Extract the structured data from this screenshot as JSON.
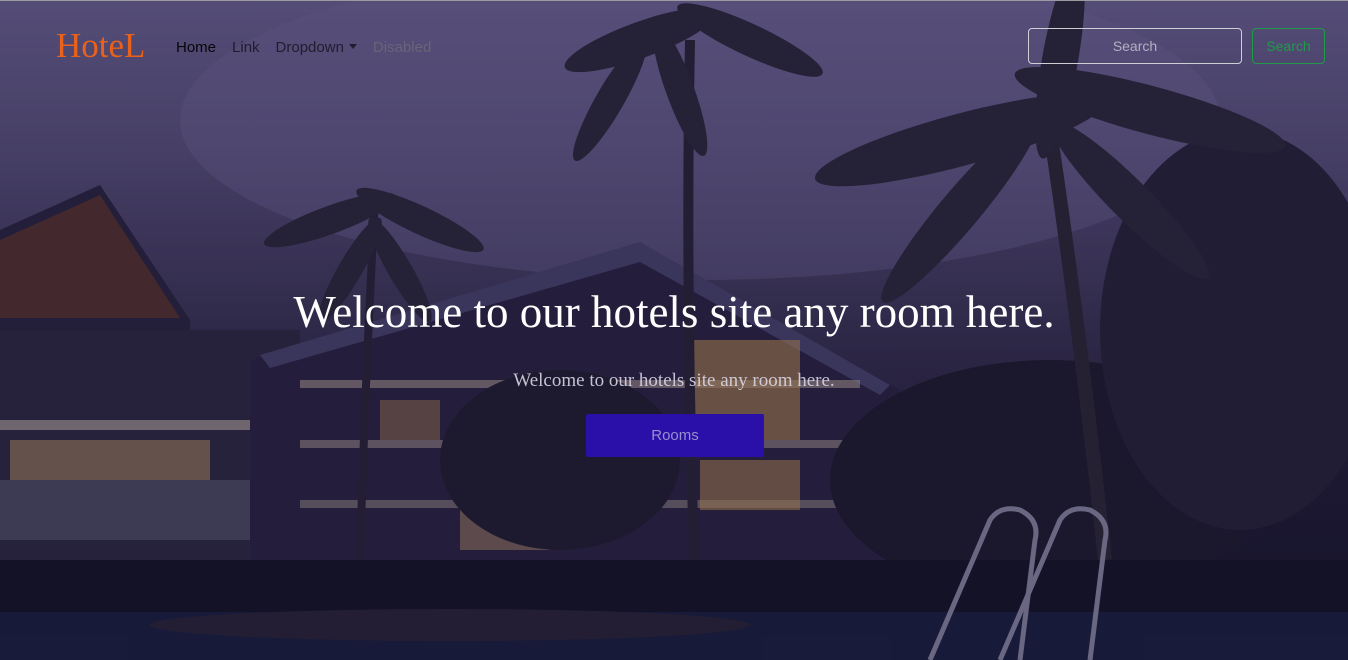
{
  "brand": {
    "name": "HoteL",
    "color": "#e8621b"
  },
  "nav": {
    "links": [
      {
        "label": "Home",
        "state": "active"
      },
      {
        "label": "Link",
        "state": "normal"
      },
      {
        "label": "Dropdown",
        "state": "dropdown"
      },
      {
        "label": "Disabled",
        "state": "disabled"
      }
    ]
  },
  "search": {
    "placeholder": "Search",
    "button_label": "Search",
    "button_color": "#1f9a4b"
  },
  "hero": {
    "title": "Welcome to our hotels site any room here.",
    "subtitle": "Welcome to our hotels site any room here.",
    "button_label": "Rooms",
    "button_color": "#2a10a8",
    "background": "dusk hotel with palm trees and pool"
  }
}
